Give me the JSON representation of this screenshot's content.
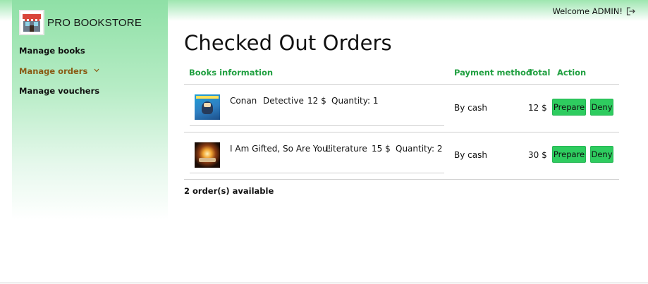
{
  "brand": {
    "name": "PRO BOOKSTORE",
    "logo_icon": "bookstore-shop-icon"
  },
  "sidebar": {
    "items": [
      {
        "label": "Manage books",
        "active": false
      },
      {
        "label": "Manage orders",
        "active": true,
        "expand_icon": "chevron-down-icon"
      },
      {
        "label": "Manage vouchers",
        "active": false
      }
    ]
  },
  "header": {
    "welcome": "Welcome ADMIN!",
    "logout_icon": "logout-icon"
  },
  "main": {
    "title": "Checked Out Orders",
    "columns": [
      "Books information",
      "Payment method",
      "Total",
      "Action"
    ],
    "orders": [
      {
        "thumbnail_icon": "book-cover-conan",
        "title": "Conan",
        "category": "Detective",
        "price": "12 $",
        "quantity": "Quantity: 1",
        "payment": "By cash",
        "total": "12 $",
        "actions": [
          "Prepare",
          "Deny"
        ]
      },
      {
        "thumbnail_icon": "book-cover-gifted",
        "title": "I Am Gifted, So Are You!",
        "category": "Literature",
        "price": "15 $",
        "quantity": "Quantity: 2",
        "payment": "By cash",
        "total": "30 $",
        "actions": [
          "Prepare",
          "Deny"
        ]
      }
    ],
    "count_text": "2 order(s) available"
  },
  "colors": {
    "accent_green": "#21a041",
    "button_green": "#2ecc5f",
    "active_nav": "#8a5a14",
    "sidebar_gradient_top": "#8fe0a6"
  }
}
